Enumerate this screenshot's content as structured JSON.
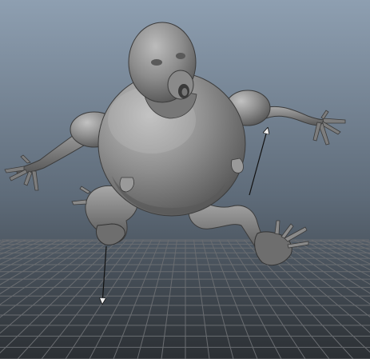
{
  "viewport": {
    "background_top": "#8e9fb1",
    "background_bottom": "#2b2f33",
    "grid_color": "#6a6d71",
    "model_color": "#8d8d8d",
    "model_shadow": "#4e4e4e",
    "model_highlight": "#bdbdbd",
    "manipulator_color": "#111111"
  },
  "scene": {
    "objects": [
      {
        "name": "character-model",
        "kind": "sculpted mesh"
      },
      {
        "name": "ground-grid",
        "kind": "perspective grid"
      },
      {
        "name": "ik-handle-left-leg",
        "kind": "manipulator arrow"
      },
      {
        "name": "ik-handle-right-leg",
        "kind": "manipulator arrow"
      }
    ]
  }
}
